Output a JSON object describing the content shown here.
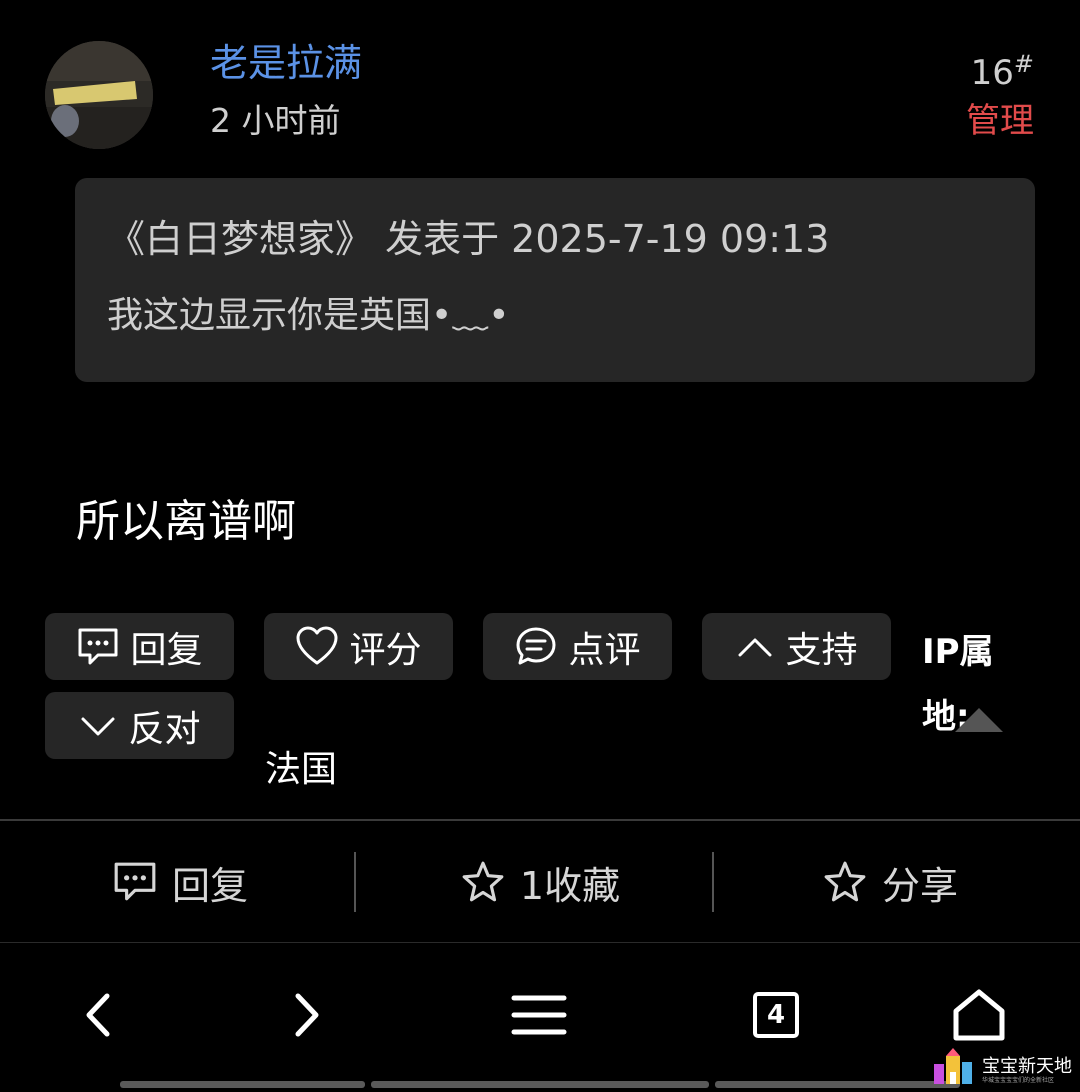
{
  "post": {
    "username": "老是拉满",
    "time": "2 小时前",
    "floor_number": "16",
    "floor_mark": "#",
    "admin_label": "管理",
    "quote": {
      "source": "《白日梦想家》 发表于 2025-7-19 09:13",
      "text": "我这边显示你是英国•﹏•"
    },
    "content": "所以离谱啊"
  },
  "buttons": {
    "reply": "回复",
    "rate": "评分",
    "comment": "点评",
    "support": "支持",
    "oppose": "反对"
  },
  "ip": {
    "label": "IP属地:",
    "value": "法国"
  },
  "action_bar": {
    "reply": "回复",
    "favorite": "1收藏",
    "share": "分享"
  },
  "nav": {
    "tab_count": "4"
  },
  "watermark": {
    "text": "宝宝新天地",
    "subtext": "华城宝宝宝宝们的全新社区"
  },
  "colors": {
    "username": "#5b92e6",
    "admin": "#e24b4b",
    "button_bg": "#262626",
    "background": "#000000"
  },
  "icons": [
    "chat-bubble-icon",
    "heart-icon",
    "comment-icon",
    "chevron-up-icon",
    "chevron-down-icon",
    "star-icon",
    "back-icon",
    "forward-icon",
    "menu-icon",
    "tabs-icon",
    "home-icon"
  ]
}
